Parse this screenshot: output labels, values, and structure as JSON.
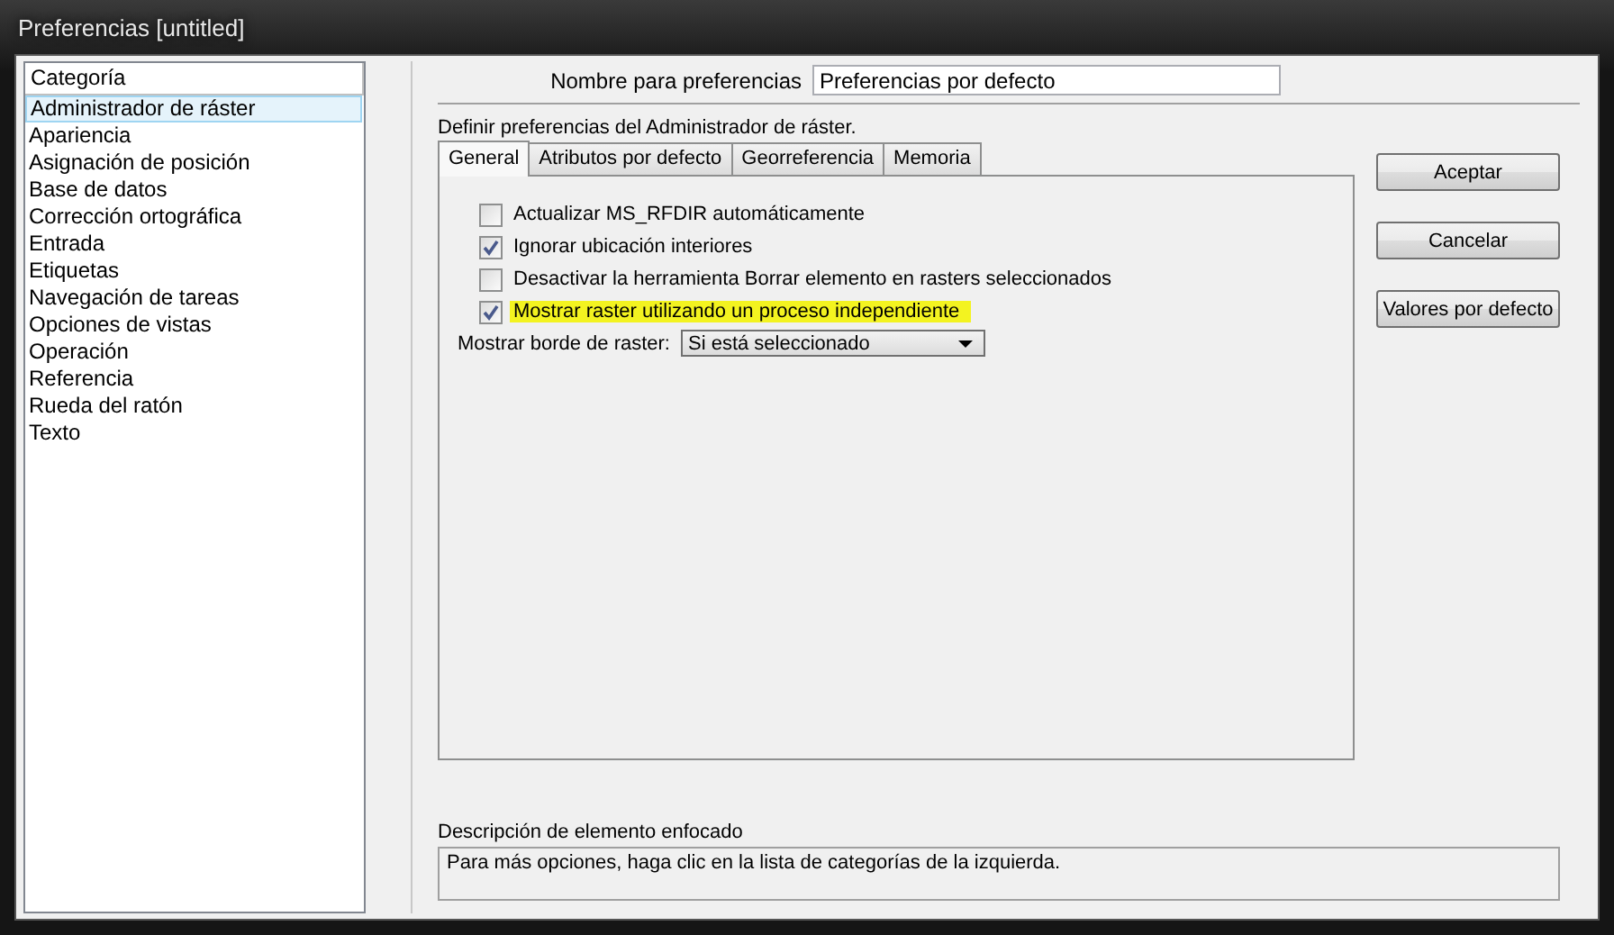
{
  "window": {
    "title": "Preferencias [untitled]"
  },
  "category_list": {
    "header": "Categoría",
    "items": [
      {
        "label": "Administrador de ráster",
        "selected": true
      },
      {
        "label": "Apariencia",
        "selected": false
      },
      {
        "label": "Asignación de posición",
        "selected": false
      },
      {
        "label": "Base de datos",
        "selected": false
      },
      {
        "label": "Corrección ortográfica",
        "selected": false
      },
      {
        "label": "Entrada",
        "selected": false
      },
      {
        "label": "Etiquetas",
        "selected": false
      },
      {
        "label": "Navegación de tareas",
        "selected": false
      },
      {
        "label": "Opciones de vistas",
        "selected": false
      },
      {
        "label": "Operación",
        "selected": false
      },
      {
        "label": "Referencia",
        "selected": false
      },
      {
        "label": "Rueda del ratón",
        "selected": false
      },
      {
        "label": "Texto",
        "selected": false
      }
    ]
  },
  "name_field": {
    "label": "Nombre para preferencias",
    "value": "Preferencias por defecto"
  },
  "section_label": "Definir preferencias del Administrador de ráster.",
  "tabs": [
    {
      "label": "General",
      "selected": true
    },
    {
      "label": "Atributos por defecto",
      "selected": false
    },
    {
      "label": "Georreferencia",
      "selected": false
    },
    {
      "label": "Memoria",
      "selected": false
    }
  ],
  "options": [
    {
      "label": "Actualizar MS_RFDIR automáticamente",
      "checked": false,
      "highlighted": false
    },
    {
      "label": "Ignorar ubicación interiores",
      "checked": true,
      "highlighted": false
    },
    {
      "label": "Desactivar la herramienta Borrar elemento en rasters seleccionados",
      "checked": false,
      "highlighted": false
    },
    {
      "label": "Mostrar raster utilizando un proceso independiente",
      "checked": true,
      "highlighted": true
    }
  ],
  "border_dropdown": {
    "label": "Mostrar borde de raster:",
    "value": "Si está seleccionado"
  },
  "buttons": [
    "Aceptar",
    "Cancelar",
    "Valores por defecto"
  ],
  "description": {
    "label": "Descripción de elemento enfocado",
    "text": "Para más opciones, haga clic en la lista de categorías de la izquierda."
  }
}
